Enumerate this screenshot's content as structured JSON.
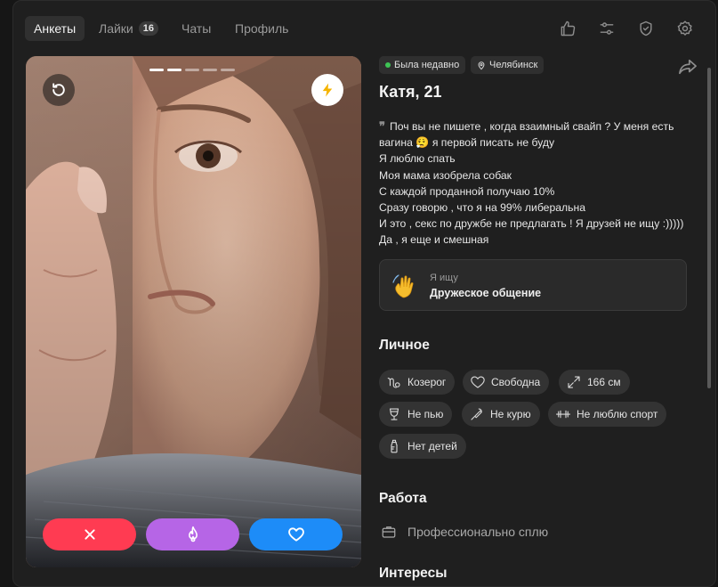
{
  "nav": {
    "tabs": [
      {
        "label": "Анкеты",
        "active": true
      },
      {
        "label": "Лайки",
        "badge": "16"
      },
      {
        "label": "Чаты"
      },
      {
        "label": "Профиль"
      }
    ],
    "icons": [
      "thumb-up-icon",
      "filters-icon",
      "shield-check-icon",
      "gear-icon"
    ]
  },
  "photo": {
    "count": 5,
    "current_index": 1,
    "rewind_icon": "rewind-icon",
    "boost_icon": "lightning-icon",
    "actions": [
      {
        "name": "dislike",
        "icon": "close-icon",
        "color": "#ff3b52"
      },
      {
        "name": "superlike",
        "icon": "flame-icon",
        "color": "#b665e6"
      },
      {
        "name": "like",
        "icon": "heart-icon",
        "color": "#1d8cf8"
      }
    ]
  },
  "profile": {
    "status": "Была недавно",
    "city": "Челябинск",
    "name": "Катя, 21",
    "bio": "Поч вы не пишете , когда взаимный свайп ? У меня есть вагина 😮‍💨 я первой писать не буду\nЯ люблю спать\nМоя мама изобрела собак\nС каждой проданной получаю 10%\nСразу говорю , что я на 99% либеральна\nИ это , секс по дружбе не предлагать ! Я друзей не ищу :))))) Да , я еще и смешная",
    "looking_label": "Я ищу",
    "looking_value": "Дружеское общение",
    "personal_title": "Личное",
    "tags": [
      {
        "icon": "capricorn-icon",
        "label": "Козерог"
      },
      {
        "icon": "heart-outline-icon",
        "label": "Свободна"
      },
      {
        "icon": "height-icon",
        "label": "166 см"
      },
      {
        "icon": "glass-icon",
        "label": "Не пью"
      },
      {
        "icon": "no-smoking-icon",
        "label": "Не курю"
      },
      {
        "icon": "dumbbell-icon",
        "label": "Не люблю спорт"
      },
      {
        "icon": "baby-bottle-icon",
        "label": "Нет детей"
      }
    ],
    "work_title": "Работа",
    "work_value": "Профессионально сплю",
    "interests_title": "Интересы"
  },
  "colors": {
    "background": "#1f1f1f",
    "online": "#3ec455",
    "dislike": "#ff3b52",
    "superlike": "#b665e6",
    "like": "#1d8cf8",
    "boost": "#f5b400"
  }
}
